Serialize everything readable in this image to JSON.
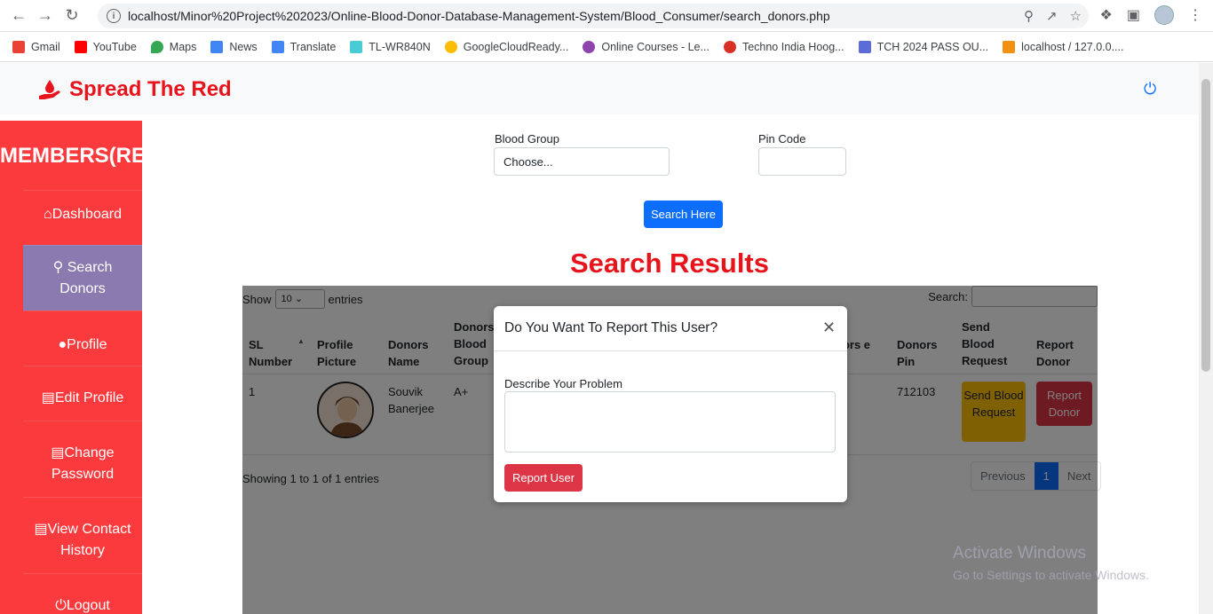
{
  "browser": {
    "url": "localhost/Minor%20Project%202023/Online-Blood-Donor-Database-Management-System/Blood_Consumer/search_donors.php",
    "bookmarks": [
      "Gmail",
      "YouTube",
      "Maps",
      "News",
      "Translate",
      "TL-WR840N",
      "GoogleCloudReady...",
      "Online Courses - Le...",
      "Techno India Hoog...",
      "TCH 2024 PASS OU...",
      "localhost / 127.0.0...."
    ]
  },
  "brand": {
    "name": "Spread The Red",
    "color": "#e8141c"
  },
  "sidebar": {
    "header": "MEMBERS(RE",
    "items": [
      "Dashboard",
      "Search Donors",
      "Profile",
      "Edit Profile",
      "Change Password",
      "View Contact History",
      "Logout"
    ],
    "active": "Search Donors",
    "bg": "#fb3a3e"
  },
  "search": {
    "blood_group_label": "Blood Group",
    "blood_group_value": "Choose...",
    "pin_label": "Pin Code",
    "button": "Search Here"
  },
  "results": {
    "title": "Search Results",
    "show_label": "Show",
    "entries_label": "entries",
    "page_length": "10",
    "search_label": "Search:",
    "headers": {
      "sl": "SL Number",
      "pic": "Profile Picture",
      "name": "Donors Name",
      "bg": "Donors Blood Group",
      "other": "nors e",
      "pin": "Donors Pin",
      "send": "Send Blood Request",
      "report": "Report Donor"
    },
    "row": {
      "sl": "1",
      "name": "Souvik Banerjee",
      "blood_group": "A+",
      "pin": "712103",
      "send_btn": "Send Blood Request",
      "report_btn": "Report Donor"
    },
    "showing": "Showing 1 to 1 of 1 entries",
    "pager": {
      "prev": "Previous",
      "current": "1",
      "next": "Next"
    }
  },
  "modal": {
    "title": "Do You Want To Report This User?",
    "label": "Describe Your Problem",
    "button": "Report User"
  },
  "watermark": {
    "line1": "Activate Windows",
    "line2": "Go to Settings to activate Windows."
  }
}
